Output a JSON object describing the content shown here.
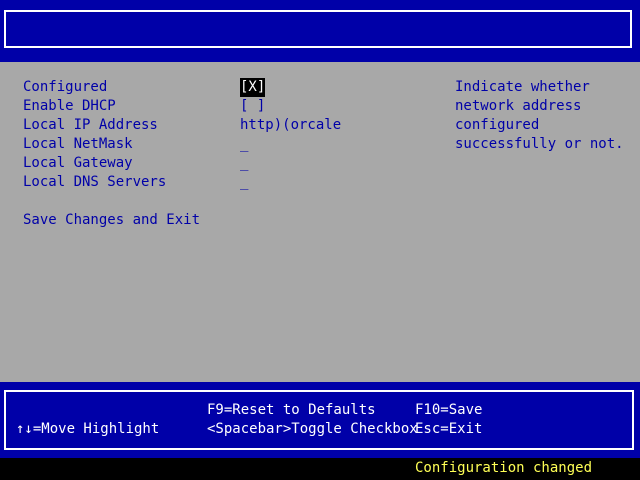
{
  "fields": [
    {
      "label": "Configured",
      "value": "[X]",
      "highlighted": true
    },
    {
      "label": "Enable DHCP",
      "value": "[ ]",
      "highlighted": false
    },
    {
      "label": "Local IP Address",
      "value": "http)(orcale",
      "highlighted": false
    },
    {
      "label": "Local NetMask",
      "value": "_",
      "highlighted": false
    },
    {
      "label": "Local Gateway",
      "value": "_",
      "highlighted": false
    },
    {
      "label": "Local DNS Servers",
      "value": "_",
      "highlighted": false
    }
  ],
  "save_exit": "Save Changes and Exit",
  "help": [
    "Indicate whether",
    "network address",
    "configured",
    "successfully or not."
  ],
  "keys": {
    "move": "↑↓=Move Highlight",
    "reset": "F9=Reset to Defaults",
    "toggle": "<Spacebar>Toggle Checkbox",
    "save": "F10=Save",
    "exit": "Esc=Exit"
  },
  "status": "Configuration changed",
  "colors": {
    "frame_blue": "#0000a8",
    "panel_gray": "#a8a8a8",
    "text_blue": "#0000a8",
    "status_yellow": "#ffff55"
  }
}
